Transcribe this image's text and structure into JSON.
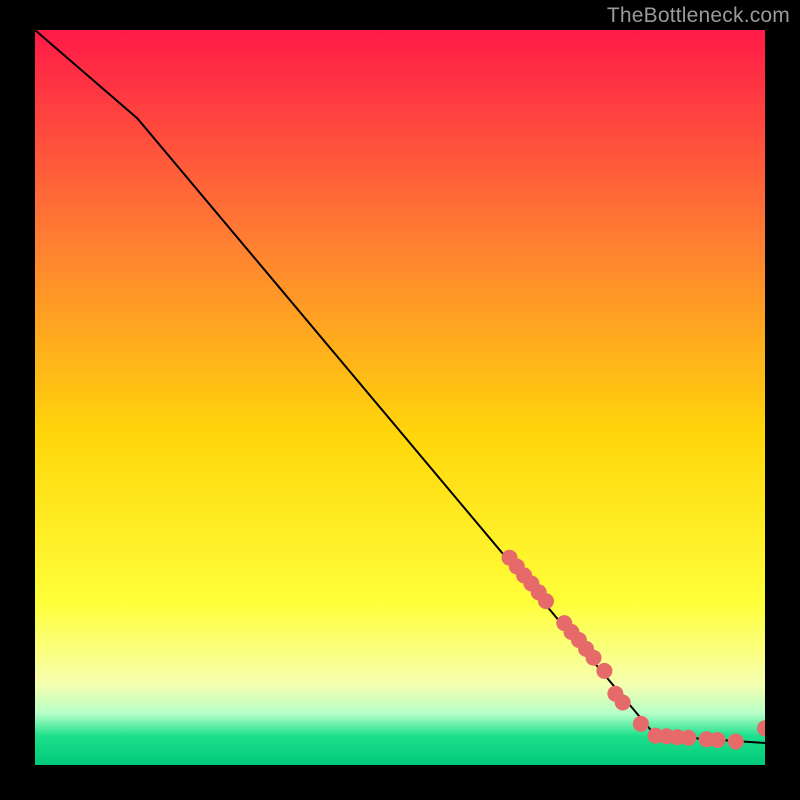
{
  "watermark": "TheBottleneck.com",
  "colors": {
    "gradient_top": "#ff1a48",
    "gradient_mid_upper": "#ff7c33",
    "gradient_mid": "#ffd60a",
    "gradient_mid_lower": "#ffff3a",
    "gradient_lower_band_top": "#f6ffb0",
    "gradient_green_upper": "#b5ffc8",
    "gradient_green": "#1fe08c",
    "gradient_bottom": "#00c97a",
    "line": "#000000",
    "marker": "#e66a6a"
  },
  "chart_data": {
    "type": "line",
    "xlim": [
      0,
      100
    ],
    "ylim": [
      0,
      100
    ],
    "line_points": [
      {
        "x": 0,
        "y": 100
      },
      {
        "x": 14,
        "y": 88
      },
      {
        "x": 85,
        "y": 4
      },
      {
        "x": 100,
        "y": 3
      }
    ],
    "marker_clusters": [
      {
        "x": 65,
        "y": 28.2
      },
      {
        "x": 66,
        "y": 27.0
      },
      {
        "x": 67,
        "y": 25.8
      },
      {
        "x": 68,
        "y": 24.7
      },
      {
        "x": 69,
        "y": 23.5
      },
      {
        "x": 70,
        "y": 22.3
      },
      {
        "x": 72.5,
        "y": 19.3
      },
      {
        "x": 73.5,
        "y": 18.1
      },
      {
        "x": 74.5,
        "y": 17.0
      },
      {
        "x": 75.5,
        "y": 15.8
      },
      {
        "x": 76.5,
        "y": 14.6
      },
      {
        "x": 78,
        "y": 12.8
      },
      {
        "x": 79.5,
        "y": 9.7
      },
      {
        "x": 80.5,
        "y": 8.5
      },
      {
        "x": 83,
        "y": 5.6
      },
      {
        "x": 85,
        "y": 4.0
      },
      {
        "x": 86.5,
        "y": 3.9
      },
      {
        "x": 88,
        "y": 3.8
      },
      {
        "x": 89.5,
        "y": 3.7
      },
      {
        "x": 92,
        "y": 3.5
      },
      {
        "x": 93.5,
        "y": 3.4
      },
      {
        "x": 96,
        "y": 3.2
      },
      {
        "x": 100,
        "y": 5.0
      }
    ]
  }
}
